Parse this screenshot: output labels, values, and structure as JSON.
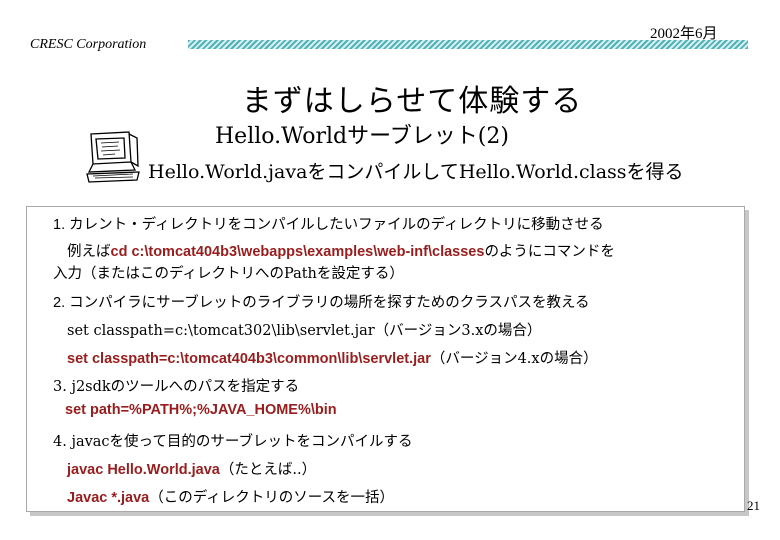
{
  "header": {
    "company": "CRESC Corporation",
    "date": "2002年6月"
  },
  "title": "まずはしらせて体験する",
  "subtitle": "Hello.Worldサーブレット(2)",
  "tagline": "Hello.World.javaをコンパイルしてHello.World.classを得る",
  "steps": {
    "s1": {
      "heading": "1.  カレント・ディレクトリをコンパイルしたいファイルのディレクトリに移動させる",
      "line2_prefix": "例えば",
      "line2_code": "cd c:\\tomcat404b3\\webapps\\examples\\web-inf\\classes",
      "line2_suffix": "のようにコマンドを",
      "line3": "入力（またはこのディレクトリへのPathを設定する）"
    },
    "s2": {
      "heading": "2.  コンパイラにサーブレットのライブラリの場所を探すためのクラスパスを教える",
      "cmd1": "set classpath=c:\\tomcat302\\lib\\servlet.jar",
      "cmd1_note": "（バージョン3.xの場合）",
      "cmd2": "set classpath=c:\\tomcat404b3\\common\\lib\\servlet.jar",
      "cmd2_note": "（バージョン4.xの場合）"
    },
    "s3": {
      "heading": "3.  j2sdkのツールへのパスを指定する",
      "cmd": "set path=%PATH%;%JAVA_HOME%\\bin"
    },
    "s4": {
      "heading": "4.   javacを使って目的のサーブレットをコンパイルする",
      "cmd1": "javac Hello.World.java",
      "cmd1_note": "（たとえば..）",
      "cmd2": "Javac *.java",
      "cmd2_note": "（このディレクトリのソースを一括）"
    }
  },
  "page_number": "21",
  "colors": {
    "code": "#9a1c1c",
    "header_bar": "#4fb3b8"
  }
}
